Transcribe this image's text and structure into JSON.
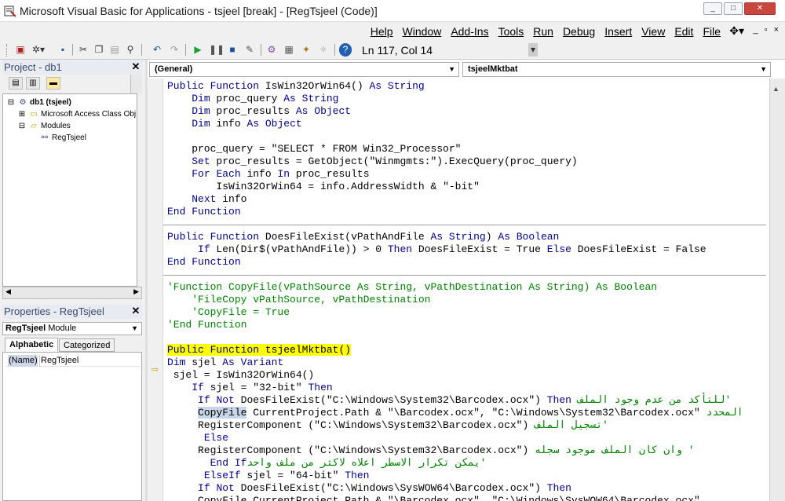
{
  "window": {
    "title": "Microsoft Visual Basic for Applications - tsjeel [break] - [RegTsjeel (Code)]",
    "controls": [
      "_",
      "□",
      "✕"
    ]
  },
  "menubar": {
    "items": [
      "Help",
      "Window",
      "Add-Ins",
      "Tools",
      "Run",
      "Debug",
      "Insert",
      "View",
      "Edit",
      "File"
    ],
    "mdi_controls": [
      "_",
      "▫",
      "×"
    ]
  },
  "toolbar": {
    "cursor_position": "Ln 117, Col 14"
  },
  "project_pane": {
    "title": "Project - db1",
    "close": "✕",
    "tree": [
      {
        "label": "db1 (tsjeel)",
        "level": 0,
        "icon": "vba-project-icon",
        "expander": "⊟"
      },
      {
        "label": "Microsoft Access Class Obj",
        "level": 1,
        "icon": "folder-icon",
        "expander": "⊞"
      },
      {
        "label": "Modules",
        "level": 1,
        "icon": "folder-open-icon",
        "expander": "⊟"
      },
      {
        "label": "RegTsjeel",
        "level": 2,
        "icon": "module-icon",
        "expander": ""
      }
    ]
  },
  "properties_pane": {
    "title": "Properties - RegTsjeel",
    "close": "✕",
    "object_combo_name": "RegTsjeel",
    "object_combo_type": "Module",
    "tabs": [
      "Alphabetic",
      "Categorized"
    ],
    "active_tab": "Alphabetic",
    "rows": [
      {
        "name": "(Name)",
        "value": "RegTsjeel"
      }
    ]
  },
  "code_window": {
    "object_combo": "(General)",
    "procedure_combo": "tsjeelMktbat",
    "lines": [
      {
        "text": "Public Function IsWin32OrWin64() As String",
        "kind": "code"
      },
      {
        "text": "    Dim proc_query As String",
        "kind": "code"
      },
      {
        "text": "    Dim proc_results As Object",
        "kind": "code"
      },
      {
        "text": "    Dim info As Object",
        "kind": "code"
      },
      {
        "text": "",
        "kind": "code"
      },
      {
        "text": "    proc_query = \"SELECT * FROM Win32_Processor\"",
        "kind": "code"
      },
      {
        "text": "    Set proc_results = GetObject(\"Winmgmts:\").ExecQuery(proc_query)",
        "kind": "code"
      },
      {
        "text": "    For Each info In proc_results",
        "kind": "code"
      },
      {
        "text": "        IsWin32OrWin64 = info.AddressWidth & \"-bit\"",
        "kind": "code"
      },
      {
        "text": "    Next info",
        "kind": "code"
      },
      {
        "text": "End Function",
        "kind": "code"
      },
      {
        "text": "",
        "kind": "code"
      },
      {
        "text": "Public Function DoesFileExist(vPathAndFile As String) As Boolean",
        "kind": "code"
      },
      {
        "text": "     If Len(Dir$(vPathAndFile)) > 0 Then DoesFileExist = True Else DoesFileExist = False",
        "kind": "code"
      },
      {
        "text": "End Function",
        "kind": "code"
      },
      {
        "text": "",
        "kind": "code"
      },
      {
        "text": "'Function CopyFile(vPathSource As String, vPathDestination As String) As Boolean",
        "kind": "comment"
      },
      {
        "text": "    'FileCopy vPathSource, vPathDestination",
        "kind": "comment"
      },
      {
        "text": "    'CopyFile = True",
        "kind": "comment"
      },
      {
        "text": "'End Function",
        "kind": "comment"
      },
      {
        "text": "",
        "kind": "code"
      },
      {
        "text": "Public Function tsjeelMktbat()",
        "kind": "highlight"
      },
      {
        "text": "Dim sjel As Variant",
        "kind": "code"
      },
      {
        "text": " sjel = IsWin32OrWin64()",
        "kind": "code"
      },
      {
        "text": "    If sjel = \"32-bit\" Then",
        "kind": "code"
      },
      {
        "text": "     If Not DoesFileExist(\"C:\\Windows\\System32\\Barcodex.ocx\") Then ",
        "kind": "code",
        "comment": "'للتأكد من عدم وجود الملف"
      },
      {
        "text": "CopyFile",
        "kind": "selected",
        "prefix": "     ",
        "rest": " CurrentProject.Path & \"\\Barcodex.ocx\", \"C:\\Windows\\System32\\Barcodex.ocx\" ",
        "comment": "المحدد"
      },
      {
        "text": "     RegisterComponent (\"C:\\Windows\\System32\\Barcodex.ocx\") ",
        "kind": "code",
        "comment": "'تسجيل الملف"
      },
      {
        "text": "      Else",
        "kind": "code"
      },
      {
        "text": "     RegisterComponent (\"C:\\Windows\\System32\\Barcodex.ocx\") ",
        "kind": "code",
        "comment": "' وان كان الملف موجود سجله"
      },
      {
        "text": "       End If",
        "kind": "code",
        "comment": "'يمكن تكرار الاسطر اعلاه لاكثر من ملف واحد"
      },
      {
        "text": "      ElseIf sjel = \"64-bit\" Then",
        "kind": "code"
      },
      {
        "text": "     If Not DoesFileExist(\"C:\\Windows\\SysWOW64\\Barcodex.ocx\") Then",
        "kind": "code"
      },
      {
        "text": "     CopyFile CurrentProject.Path & \"\\Barcodex.ocx\", \"C:\\Windows\\SysWOW64\\Barcodex.ocx\"",
        "kind": "code"
      }
    ]
  }
}
